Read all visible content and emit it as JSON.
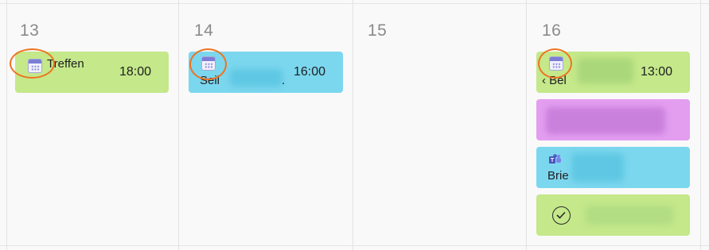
{
  "days": [
    {
      "number": "13"
    },
    {
      "number": "14"
    },
    {
      "number": "15"
    },
    {
      "number": "16"
    }
  ],
  "events": {
    "d13_e1": {
      "title": "Treffen",
      "time": "18:00",
      "color": "#c4e88a"
    },
    "d14_e1": {
      "title": "Seil",
      "suffix": ".",
      "time": "16:00",
      "color": "#7bd7ee"
    },
    "d16_e1": {
      "title": "‹ Bel",
      "time": "13:00",
      "color": "#c4e88a"
    },
    "d16_e2": {
      "color": "#e39ef0"
    },
    "d16_e3": {
      "title": "Brie",
      "color": "#7bd7ee"
    },
    "d16_e4": {
      "color": "#c4e88a"
    }
  },
  "icons": {
    "calendar": "calendar-icon",
    "teams": "teams-icon",
    "task": "checkmark-circle-icon"
  },
  "colors": {
    "highlight_ring": "#ef7322",
    "day_number": "#8a8a8a"
  }
}
